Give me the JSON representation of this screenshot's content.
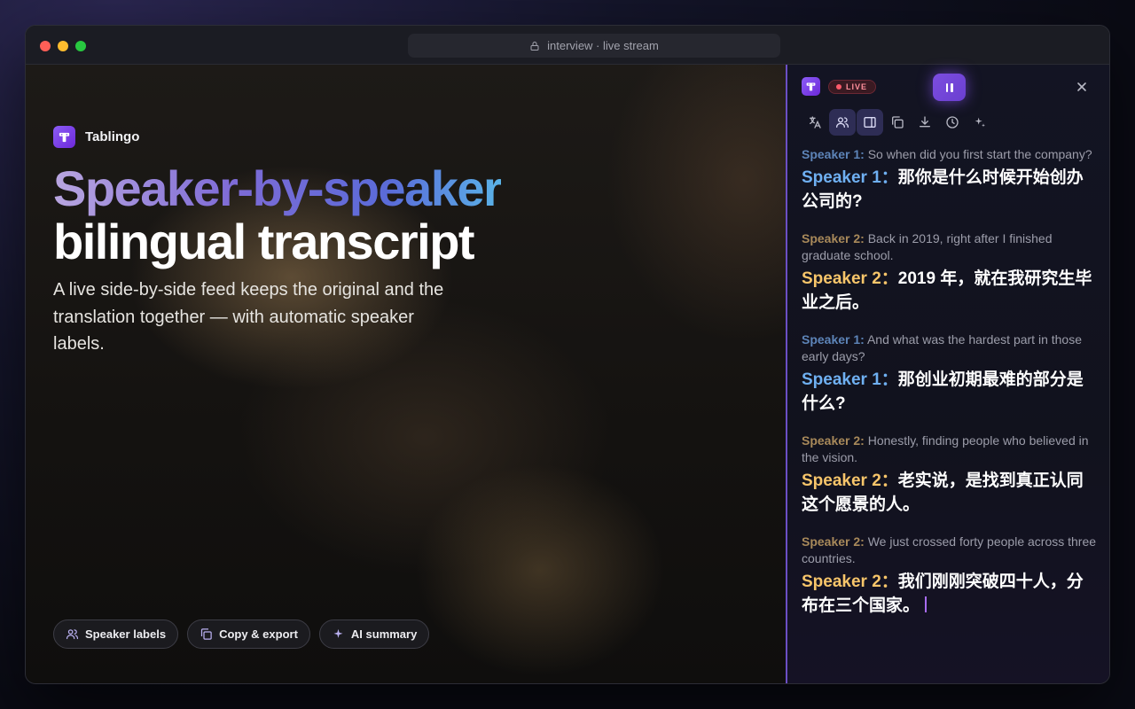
{
  "window": {
    "url_text": "interview · live stream"
  },
  "hero": {
    "brand": "Tablingo",
    "headline_line1": "Speaker-by-speaker",
    "headline_line2": "bilingual transcript",
    "subtitle": "A live side-by-side feed keeps the original and the translation together — with automatic speaker labels.",
    "chips": [
      {
        "label": "Speaker labels",
        "icon": "users-icon"
      },
      {
        "label": "Copy & export",
        "icon": "copy-icon"
      },
      {
        "label": "AI summary",
        "icon": "sparkle-icon"
      }
    ]
  },
  "panel": {
    "live_label": "LIVE",
    "toolbar": [
      "translate-icon",
      "users-icon",
      "sidebar-icon",
      "copy-icon",
      "download-icon",
      "history-icon",
      "sparkles-icon"
    ],
    "entries": [
      {
        "speaker": "Speaker 1:",
        "speaker_tr": "Speaker 1：",
        "original": "So when did you first start the company?",
        "translation": "那你是什么时候开始创办公司的?"
      },
      {
        "speaker": "Speaker 2:",
        "speaker_tr": "Speaker 2：",
        "original": "Back in 2019, right after I finished graduate school.",
        "translation": "2019 年，就在我研究生毕业之后。"
      },
      {
        "speaker": "Speaker 1:",
        "speaker_tr": "Speaker 1：",
        "original": "And what was the hardest part in those early days?",
        "translation": "那创业初期最难的部分是什么?"
      },
      {
        "speaker": "Speaker 2:",
        "speaker_tr": "Speaker 2：",
        "original": "Honestly, finding people who believed in the vision.",
        "translation": "老实说，是找到真正认同这个愿景的人。"
      },
      {
        "speaker": "Speaker 2:",
        "speaker_tr": "Speaker 2：",
        "original": "We just crossed forty people across three countries.",
        "translation": "我们刚刚突破四十人，分布在三个国家。"
      }
    ]
  },
  "colors": {
    "speaker1": "#6fb0f2",
    "speaker2": "#f7c56a",
    "accent": "#7c4de0",
    "live": "#ff5a6a"
  }
}
